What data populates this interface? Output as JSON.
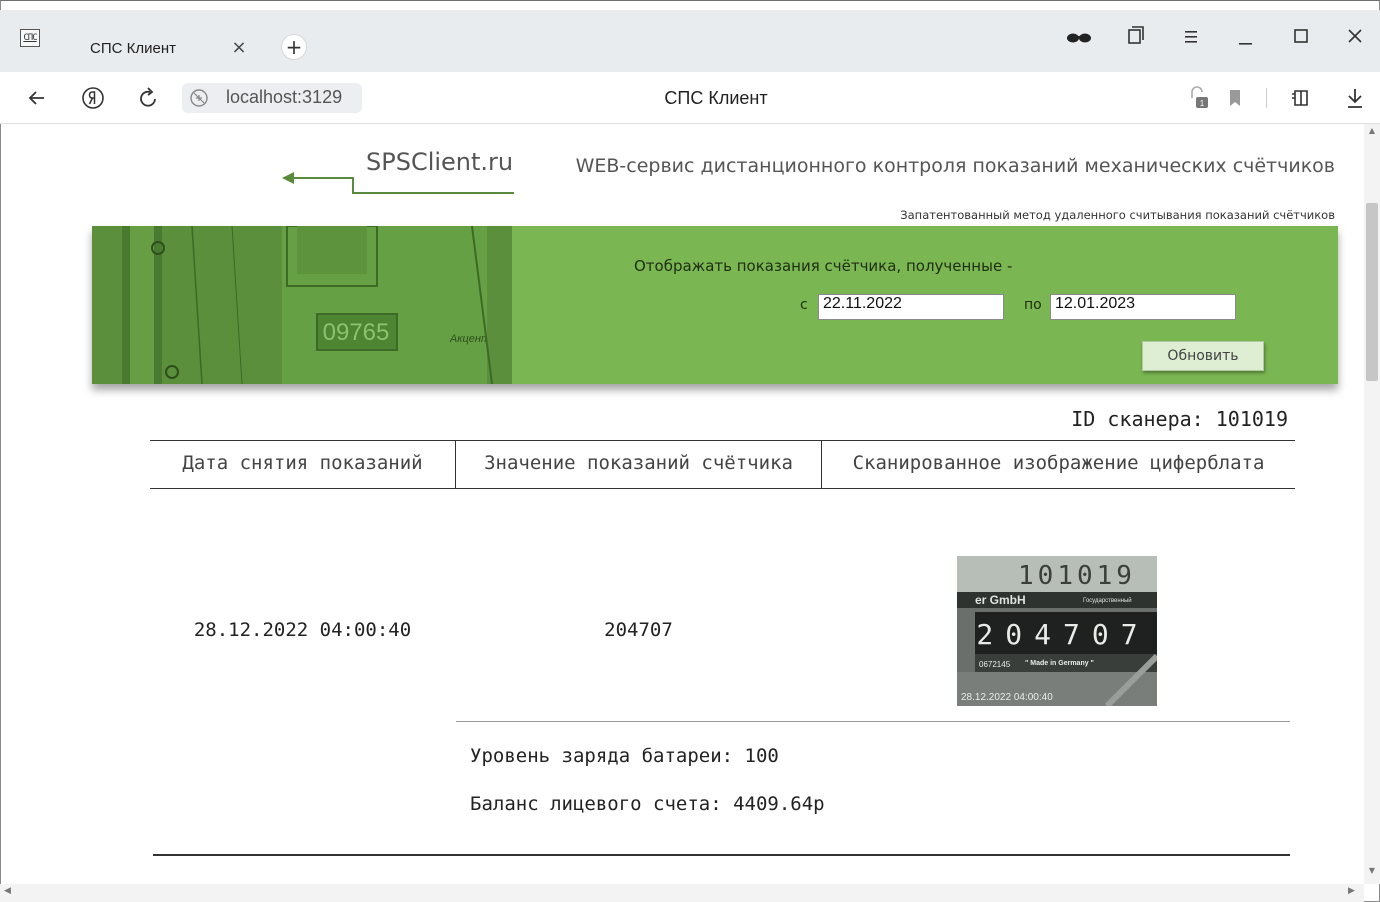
{
  "browser": {
    "tab_favicon_text": "СПС",
    "tab_title": "СПС Клиент",
    "tab_close": "×",
    "new_tab": "+",
    "url": "localhost:3129",
    "page_title": "СПС Клиент",
    "icons": {
      "back": "arrow-left-icon",
      "yandex": "yandex-icon",
      "reload": "reload-icon",
      "site_info": "site-info-icon",
      "glasses": "glasses-icon",
      "collections": "collections-icon",
      "menu": "menu-icon",
      "minimize": "minimize-icon",
      "maximize": "maximize-icon",
      "close": "close-icon",
      "extensions": "extensions-icon",
      "bookmark": "bookmark-icon",
      "sidebar": "sidebar-icon",
      "download": "download-icon"
    }
  },
  "header": {
    "brand": "SPSClient.ru",
    "service_title": "WEB-сервис дистанционного контроля показаний механических счётчиков",
    "patent_note": "Запатентованный метод удаленного считывания показаний счётчиков"
  },
  "banner": {
    "meter_digits": "09765",
    "meter_brand": "Акцент",
    "filter_label": "Отображать показания счётчика, полученные  -",
    "from_label": "с",
    "from_value": "22.11.2022",
    "to_label": "по",
    "to_value": "12.01.2023",
    "refresh_label": "Обновить",
    "color": "#7ab651"
  },
  "scanner": {
    "id_text": "ID сканера: 101019"
  },
  "table": {
    "headers": [
      "Дата снятия показаний",
      "Значение показаний счётчика",
      "Сканированное изображение циферблата"
    ],
    "rows": [
      {
        "date": "28.12.2022 04:00:40",
        "value": "204707",
        "image": {
          "top_digits": "101019",
          "maker": "er GmbH",
          "state": "Государственный",
          "dial_digits": "204707",
          "serial": "0672145",
          "made_in": "\" Made in Germany \"",
          "timestamp": "28.12.2022 04:00:40"
        }
      }
    ],
    "battery_text": "Уровень заряда батареи: 100",
    "balance_text": "Баланс лицевого счета: 4409.64р"
  }
}
